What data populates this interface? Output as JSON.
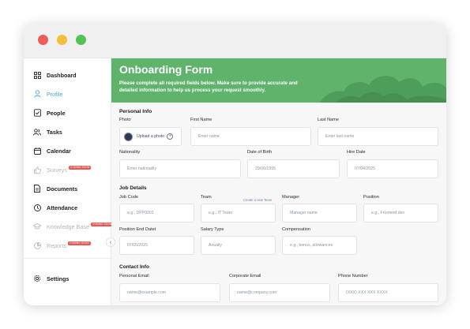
{
  "window": {
    "controls": [
      "close",
      "minimize",
      "maximize"
    ]
  },
  "sidebar": {
    "items": [
      {
        "label": "Dashboard",
        "icon": "grid-icon",
        "state": "normal"
      },
      {
        "label": "Profile",
        "icon": "user-icon",
        "state": "active"
      },
      {
        "label": "People",
        "icon": "people-icon",
        "state": "normal"
      },
      {
        "label": "Tasks",
        "icon": "tasks-icon",
        "state": "normal"
      },
      {
        "label": "Calendar",
        "icon": "calendar-icon",
        "state": "normal"
      },
      {
        "label": "Surveys",
        "icon": "thumbs-up-icon",
        "state": "disabled",
        "badge": "COMING SOON"
      },
      {
        "label": "Documents",
        "icon": "document-icon",
        "state": "normal"
      },
      {
        "label": "Attendance",
        "icon": "clock-icon",
        "state": "normal"
      },
      {
        "label": "Knowledge Base",
        "icon": "graduation-cap-icon",
        "state": "disabled",
        "badge": "COMING SOON"
      },
      {
        "label": "Reports",
        "icon": "pie-chart-icon",
        "state": "disabled",
        "badge": "COMING SOON"
      }
    ],
    "settings_label": "Settings",
    "collapse_glyph": "‹"
  },
  "hero": {
    "title": "Onboarding Form",
    "subtitle": "Please complete all required fields below. Make sure to provide accurate and detailed information to help us process your request smoothly.",
    "color": "#5fb36b"
  },
  "personal": {
    "title": "Personal Info",
    "photo_label": "Photo",
    "upload_label": "Upload a photo",
    "first_name_label": "First Name",
    "first_name_placeholder": "Enter name",
    "last_name_label": "Last Name",
    "last_name_placeholder": "Enter last name",
    "nationality_label": "Nationality",
    "nationality_placeholder": "Enter nationality",
    "dob_label": "Date of Birth",
    "dob_value": "29/06/1995",
    "hire_label": "Hire Date",
    "hire_value": "07/04/2025"
  },
  "job": {
    "title": "Job Details",
    "code_label": "Job Code",
    "code_placeholder": "e.g., DPP0001",
    "team_label": "Team",
    "create_team": "Create a new Team",
    "team_placeholder": "e.g., IT Team",
    "manager_label": "Manager",
    "manager_placeholder": "Manager name",
    "position_label": "Position",
    "position_placeholder": "e.g., Frontend dev",
    "end_label": "Position End Datet",
    "end_value": "07/05/2025",
    "salary_label": "Salary Type",
    "salary_value": "Anually",
    "comp_label": "Compensation",
    "comp_placeholder": "e.g., bonus, allowances"
  },
  "contact": {
    "title": "Contact Info",
    "personal_email_label": "Personal Email",
    "personal_email_placeholder": "name@example.com",
    "corporate_email_label": "Corporate Email",
    "corporate_email_placeholder": "name@company.com",
    "phone_label": "Phone Number",
    "phone_placeholder": "(XXX) XXX XXX XXXX"
  }
}
